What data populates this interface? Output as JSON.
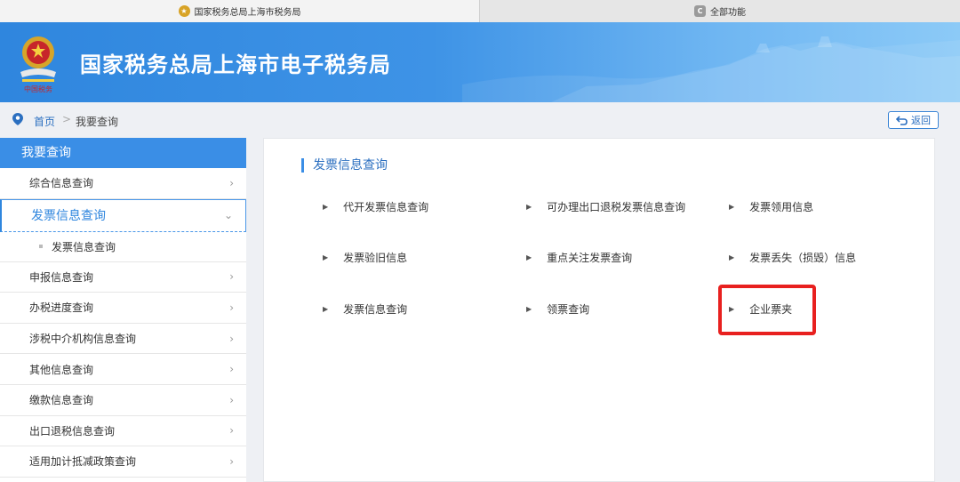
{
  "browser": {
    "tabs": [
      {
        "label": "国家税务总局上海市税务局",
        "icon": "emblem-icon"
      },
      {
        "label": "全部功能",
        "icon": "c-app-icon",
        "icon_glyph": "C"
      }
    ]
  },
  "header": {
    "title": "国家税务总局上海市电子税务局",
    "emblem_text": "中国税务"
  },
  "breadcrumb": {
    "home": "首页",
    "separator": ">",
    "current": "我要查询",
    "back_label": "返回"
  },
  "sidebar": {
    "title": "我要查询",
    "items": [
      {
        "label": "综合信息查询"
      },
      {
        "label": "发票信息查询",
        "active": true,
        "sub": "发票信息查询"
      },
      {
        "label": "申报信息查询"
      },
      {
        "label": "办税进度查询"
      },
      {
        "label": "涉税中介机构信息查询"
      },
      {
        "label": "其他信息查询"
      },
      {
        "label": "缴款信息查询"
      },
      {
        "label": "出口退税信息查询"
      },
      {
        "label": "适用加计抵减政策查询"
      }
    ]
  },
  "main": {
    "section_title": "发票信息查询",
    "links": [
      "代开发票信息查询",
      "可办理出口退税发票信息查询",
      "发票领用信息",
      "发票验旧信息",
      "重点关注发票查询",
      "发票丢失（损毁）信息",
      "发票信息查询",
      "领票查询",
      "企业票夹"
    ],
    "highlighted_link": "企业票夹",
    "highlight_color": "#e8201f"
  },
  "colors": {
    "accent": "#2f86de",
    "banner_start": "#2f86de",
    "banner_end": "#8ccaf7"
  }
}
